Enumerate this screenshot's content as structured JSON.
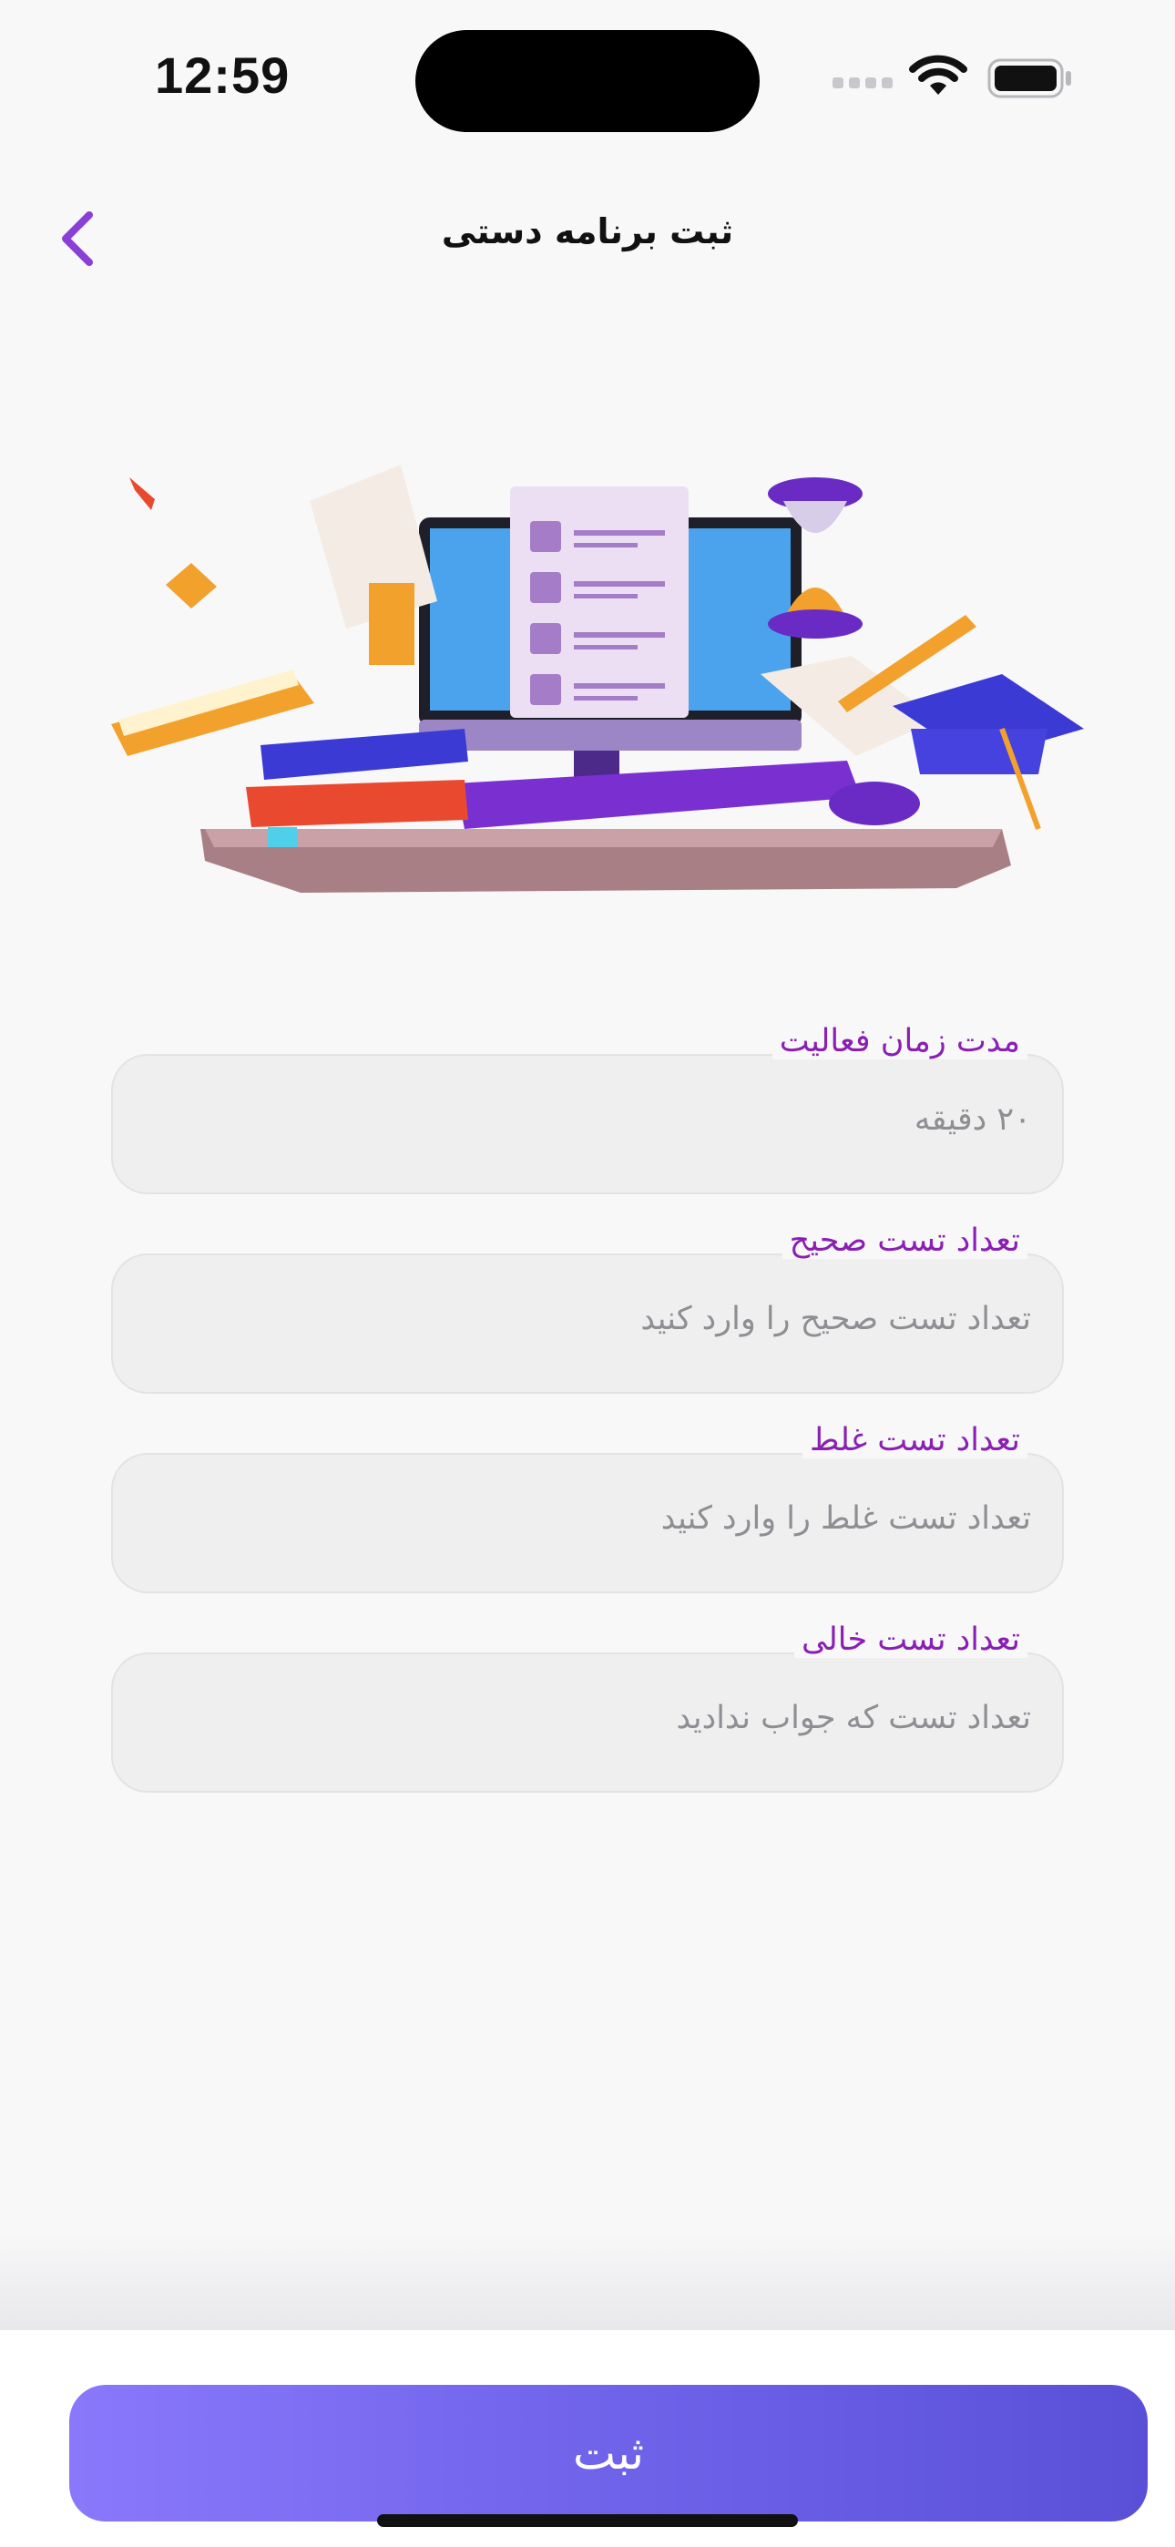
{
  "status_bar": {
    "time": "12:59"
  },
  "header": {
    "title": "ثبت برنامه دستی",
    "accent_color": "#8a3fd6"
  },
  "form": {
    "fields": [
      {
        "label": "مدت زمان فعالیت",
        "value": "۲۰ دقیقه"
      },
      {
        "label": "تعداد تست صحیح",
        "placeholder": "تعداد تست صحیح را وارد کنید"
      },
      {
        "label": "تعداد تست غلط",
        "placeholder": "تعداد تست غلط را وارد کنید"
      },
      {
        "label": "تعداد تست خالی",
        "placeholder": "تعداد تست که جواب ندادید"
      }
    ],
    "label_color": "#8a1fb3"
  },
  "footer": {
    "submit_label": "ثبت",
    "button_gradient": [
      "#8a78fb",
      "#5a50d8"
    ]
  }
}
